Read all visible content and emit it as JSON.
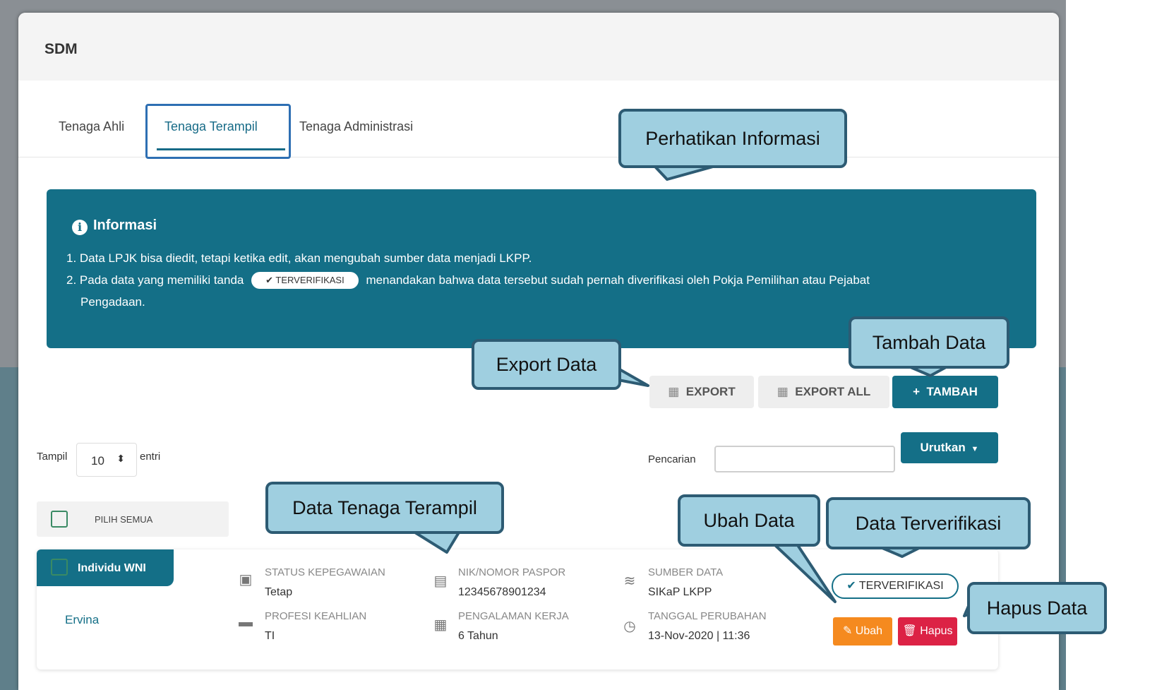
{
  "window": {
    "title": "SDM"
  },
  "tabs": [
    {
      "label": "Tenaga Ahli",
      "active": false
    },
    {
      "label": "Tenaga Terampil",
      "active": true
    },
    {
      "label": "Tenaga Administrasi",
      "active": false
    }
  ],
  "info": {
    "title": "Informasi",
    "line1": "1. Data LPJK bisa diedit, tetapi ketika edit, akan mengubah sumber data menjadi LKPP.",
    "line2_pre": "2. Pada data yang memiliki tanda",
    "line2_badge": "TERVERIFIKASI",
    "line2_post": "menandakan bahwa data tersebut sudah pernah diverifikasi oleh Pokja Pemilihan atau Pejabat",
    "line3": "Pengadaan."
  },
  "actions": {
    "export_label": "EXPORT",
    "export_all_label": "EXPORT ALL",
    "tambah_label": "TAMBAH"
  },
  "table_controls": {
    "show_label": "Tampil",
    "page_size": "10",
    "entries_label": "entri",
    "search_label": "Pencarian",
    "search_value": "",
    "sort_label": "Urutkan",
    "select_all_label": "PILIH SEMUA"
  },
  "record": {
    "type_label": "Individu WNI",
    "name": "Ervina",
    "status_label": "STATUS KEPEGAWAIAN",
    "status_value": "Tetap",
    "profesi_label": "PROFESI KEAHLIAN",
    "profesi_value": "TI",
    "nik_label": "NIK/NOMOR PASPOR",
    "nik_value": "12345678901234",
    "pengalaman_label": "PENGALAMAN KERJA",
    "pengalaman_value": "6 Tahun",
    "sumber_label": "SUMBER DATA",
    "sumber_value": "SIKaP LKPP",
    "tanggal_label": "TANGGAL PERUBAHAN",
    "tanggal_value": "13-Nov-2020 | 11:36",
    "verified_label": "TERVERIFIKASI",
    "edit_label": "Ubah",
    "delete_label": "Hapus"
  },
  "callouts": {
    "perhatikan": "Perhatikan Informasi",
    "export": "Export Data",
    "tambah": "Tambah Data",
    "data_tenaga": "Data Tenaga Terampil",
    "ubah": "Ubah Data",
    "terverifikasi": "Data Terverifikasi",
    "hapus": "Hapus Data"
  },
  "colors": {
    "primary": "#146f87",
    "callout_fill": "#9fcfe0",
    "callout_border": "#2d5b73",
    "edit": "#f58a1f",
    "delete": "#dc2245"
  }
}
